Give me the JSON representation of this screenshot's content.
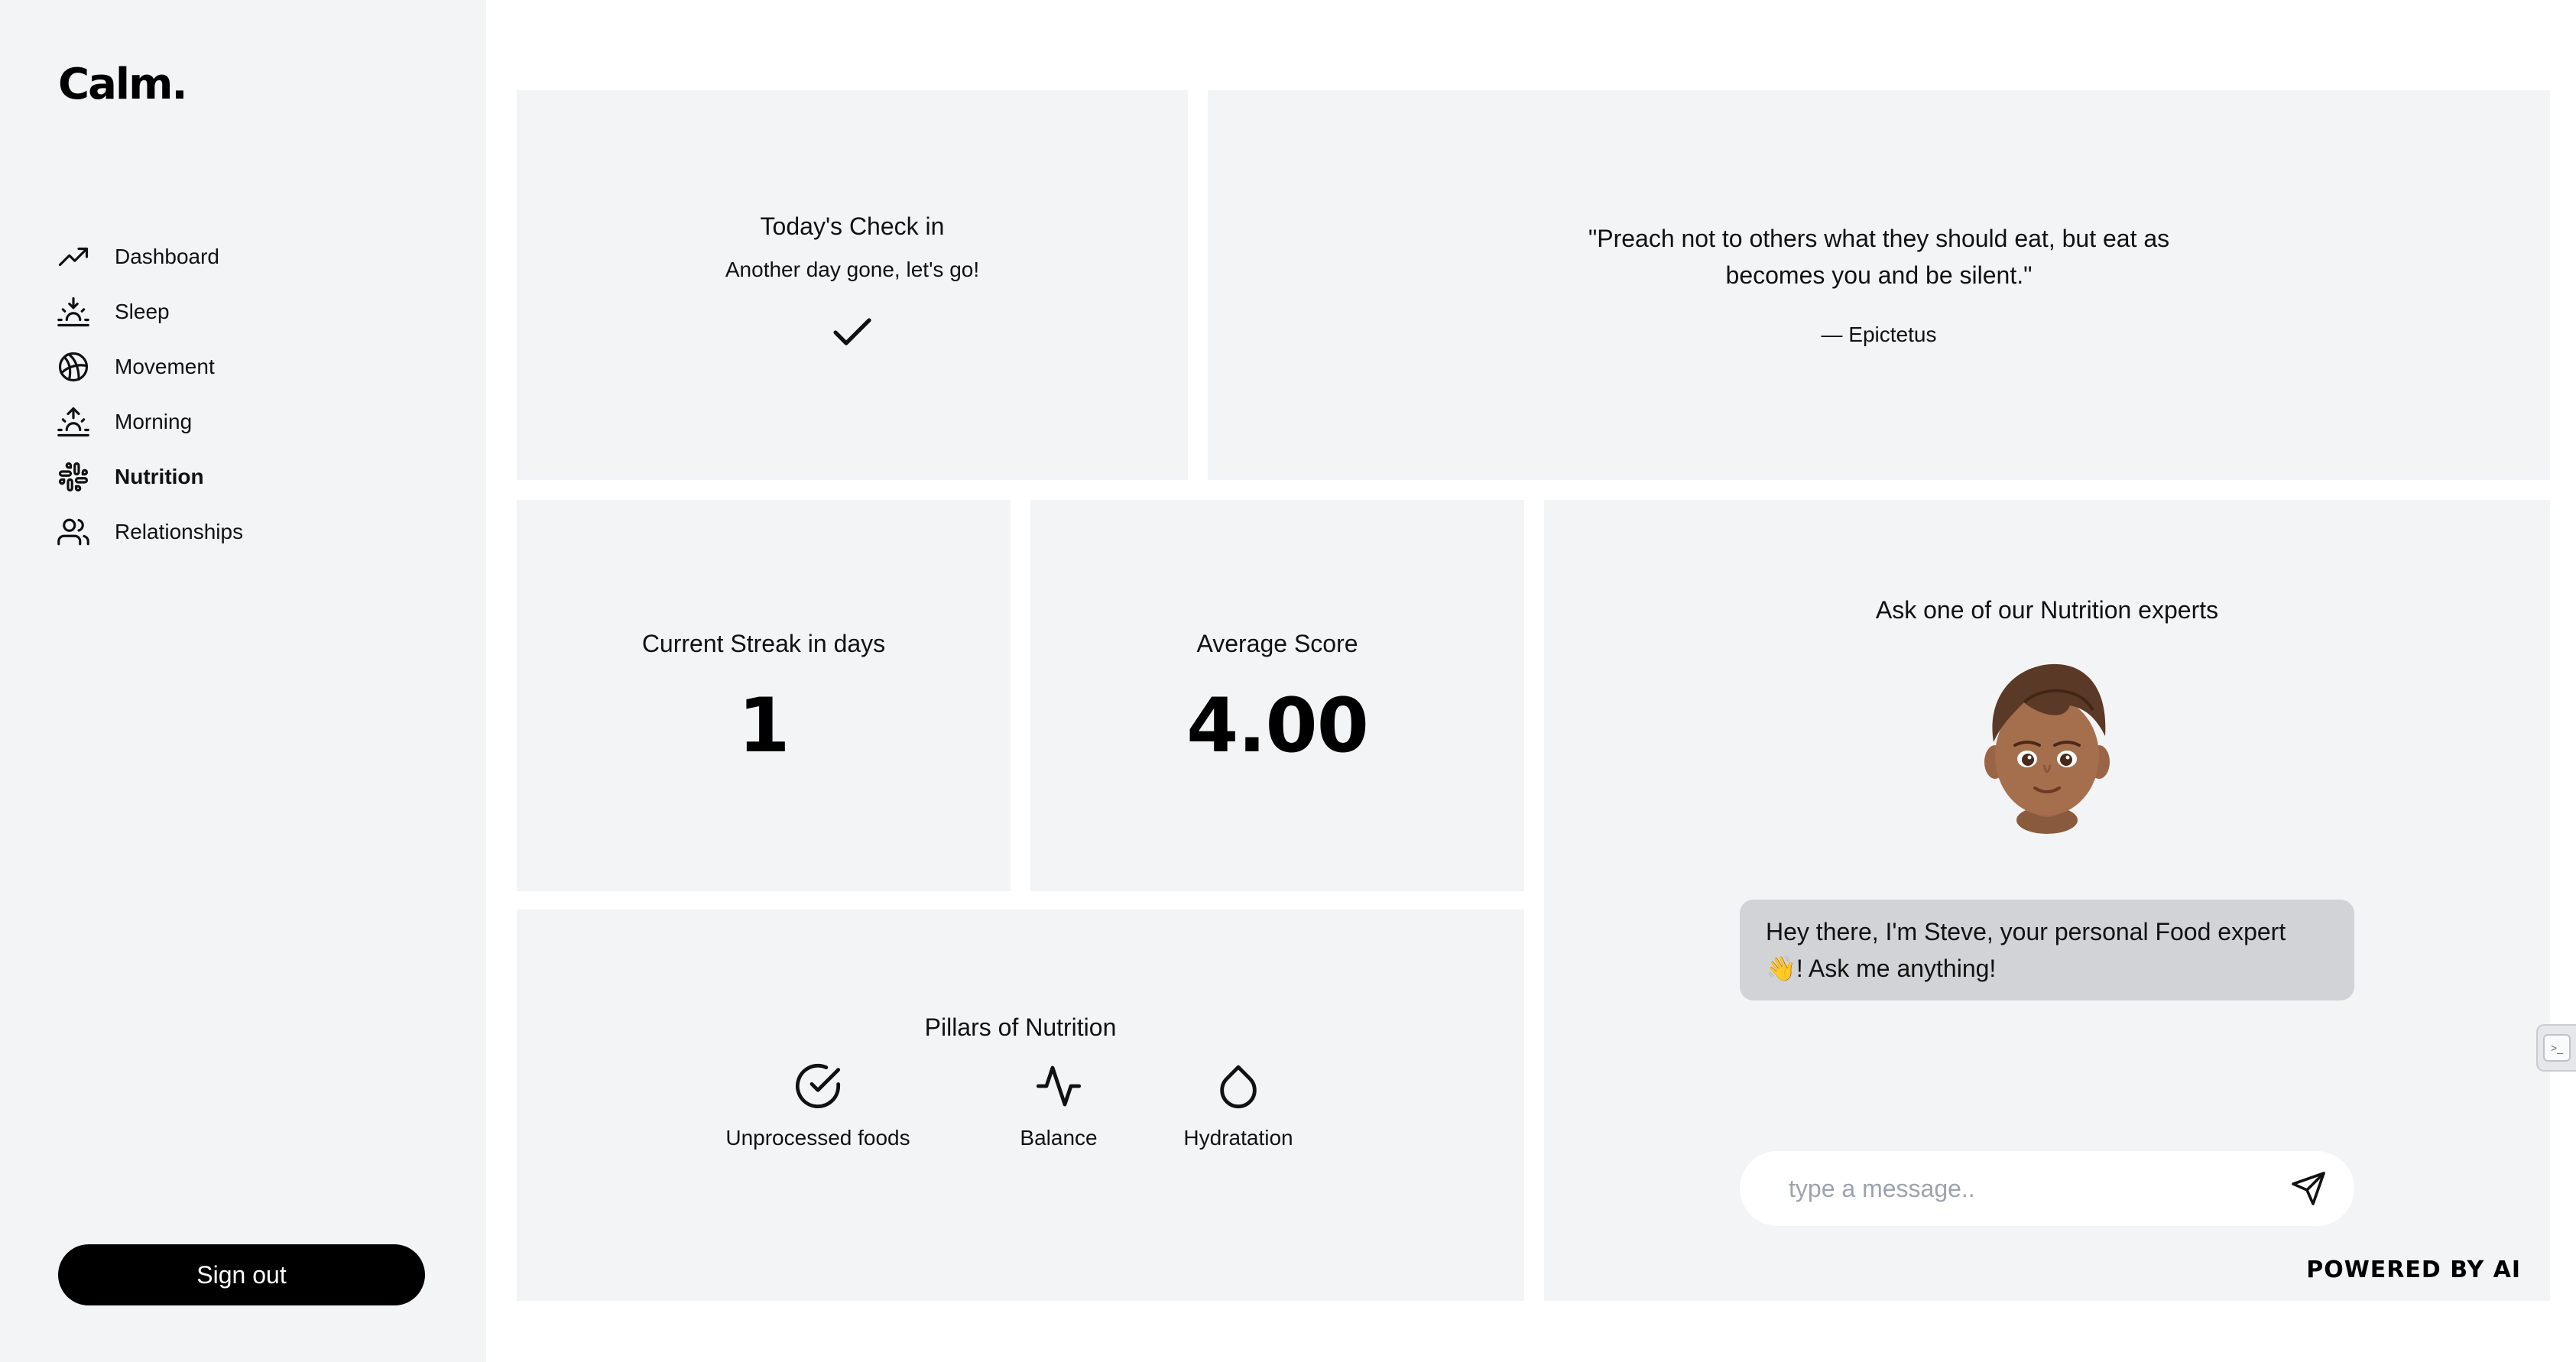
{
  "app": {
    "logo": "Calm."
  },
  "sidebar": {
    "items": [
      {
        "label": "Dashboard",
        "icon": "trending-up-icon",
        "active": false
      },
      {
        "label": "Sleep",
        "icon": "sunset-icon",
        "active": false
      },
      {
        "label": "Movement",
        "icon": "basketball-icon",
        "active": false
      },
      {
        "label": "Morning",
        "icon": "sunrise-icon",
        "active": false
      },
      {
        "label": "Nutrition",
        "icon": "slack-icon",
        "active": true
      },
      {
        "label": "Relationships",
        "icon": "users-icon",
        "active": false
      }
    ],
    "signout_label": "Sign out"
  },
  "checkin": {
    "title": "Today's Check in",
    "subtitle": "Another day gone, let's go!",
    "status_icon": "check-icon"
  },
  "quote": {
    "text": "\"Preach not to others what they should eat, but eat as becomes you and be silent.\"",
    "author": "— Epictetus"
  },
  "streak": {
    "label": "Current Streak in days",
    "value": "1"
  },
  "average": {
    "label": "Average Score",
    "value": "4.00"
  },
  "pillars": {
    "title": "Pillars of Nutrition",
    "items": [
      {
        "label": "Unprocessed foods",
        "icon": "check-circle-icon"
      },
      {
        "label": "Balance",
        "icon": "activity-icon"
      },
      {
        "label": "Hydratation",
        "icon": "droplet-icon"
      }
    ]
  },
  "expert": {
    "title": "Ask one of our Nutrition experts",
    "avatar": "boy-memoji-avatar",
    "message": "Hey there, I'm Steve, your personal Food expert 👋! Ask me anything!",
    "input_placeholder": "type a message..",
    "input_value": "",
    "send_icon": "send-icon",
    "powered_by": "POWERED BY AI"
  },
  "colors": {
    "panel": "#f3f4f6",
    "bubble": "#d1d3d6",
    "primary": "#000000"
  }
}
